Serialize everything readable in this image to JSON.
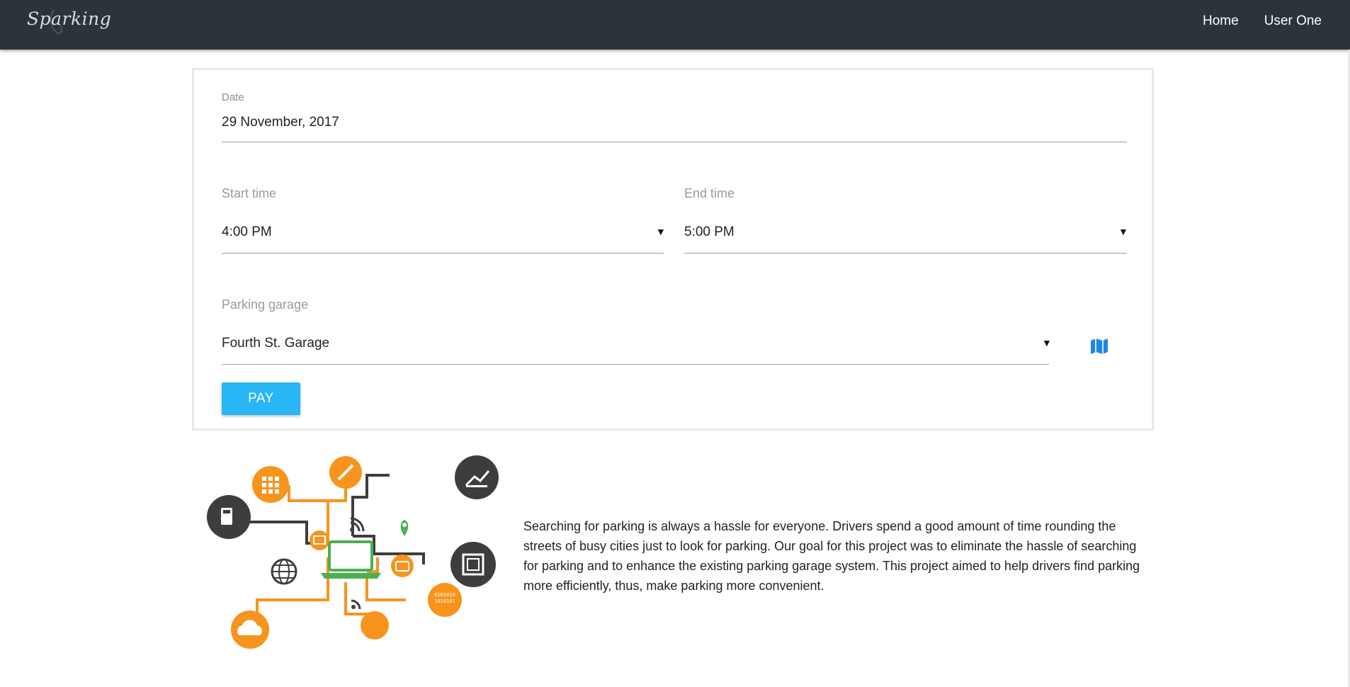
{
  "brand": {
    "name": "Sparking"
  },
  "nav": {
    "home": "Home",
    "user": "User One"
  },
  "form": {
    "date": {
      "label": "Date",
      "value": "29 November, 2017"
    },
    "start_time": {
      "label": "Start time",
      "value": "4:00 PM"
    },
    "end_time": {
      "label": "End time",
      "value": "5:00 PM"
    },
    "garage": {
      "label": "Parking garage",
      "value": "Fourth St. Garage"
    },
    "pay_label": "PAY"
  },
  "description": "Searching for parking is always a hassle for everyone. Drivers spend a good amount of time rounding the streets of busy cities just to look for parking. Our goal for this project was to eliminate the hassle of searching for parking and to enhance the existing parking garage system. This project aimed to help drivers find parking more efficiently, thus, make parking more convenient.",
  "colors": {
    "navbar": "#2b333b",
    "accent": "#29b6f6",
    "orange": "#f7941d",
    "dark_circle": "#3d3d3d",
    "green": "#4caf50"
  },
  "icons": {
    "map": "map-icon",
    "dropdown": "caret-down-icon"
  }
}
